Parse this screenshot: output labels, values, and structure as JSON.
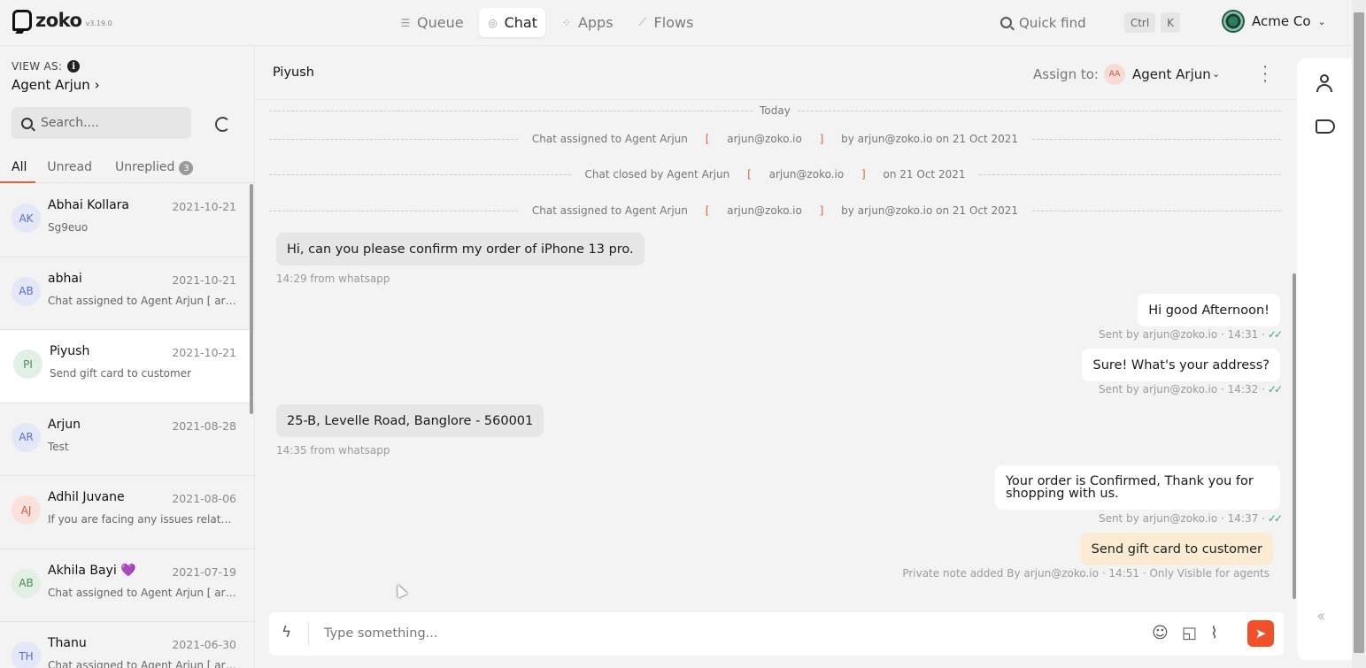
{
  "app": {
    "name": "zoko",
    "version": "v3.19.0"
  },
  "nav": {
    "items": [
      {
        "label": "Queue",
        "icon": "queue-icon"
      },
      {
        "label": "Chat",
        "icon": "chat-icon",
        "active": true
      },
      {
        "label": "Apps",
        "icon": "apps-grid-icon"
      },
      {
        "label": "Flows",
        "icon": "flows-icon"
      }
    ]
  },
  "quickfind": {
    "placeholder": "Quick find",
    "key1": "Ctrl",
    "key2": "K"
  },
  "org": {
    "name": "Acme Co"
  },
  "sidebar": {
    "view_as_label": "VIEW AS:",
    "view_as_agent": "Agent Arjun",
    "search_placeholder": "Search....",
    "tabs": [
      {
        "label": "All",
        "active": true
      },
      {
        "label": "Unread"
      },
      {
        "label": "Unreplied",
        "badge": "3"
      }
    ],
    "conversations": [
      {
        "initials": "AK",
        "name": "Abhai Kollara",
        "date": "2021-10-21",
        "preview": "Sg9euo",
        "avatar_bg": "#e3e7f7",
        "avatar_fg": "#5b6fc7"
      },
      {
        "initials": "AB",
        "name": "abhai",
        "date": "2021-10-21",
        "preview": "Chat assigned to Agent Arjun [ arjun@zoko.io ]",
        "avatar_bg": "#e3e7f7",
        "avatar_fg": "#5b6fc7"
      },
      {
        "initials": "PI",
        "name": "Piyush",
        "date": "2021-10-21",
        "preview": "Send gift card to customer",
        "avatar_bg": "#e1efe4",
        "avatar_fg": "#4f8a5c",
        "selected": true
      },
      {
        "initials": "AR",
        "name": "Arjun",
        "date": "2021-08-28",
        "preview": "Test",
        "avatar_bg": "#e3e7f7",
        "avatar_fg": "#5b6fc7"
      },
      {
        "initials": "AJ",
        "name": "Adhil Juvane",
        "date": "2021-08-06",
        "preview": "If you are facing any issues related to your order",
        "avatar_bg": "#fbe1dc",
        "avatar_fg": "#d05a3d"
      },
      {
        "initials": "AB",
        "name": "Akhila Bayi",
        "name_emoji": "💜",
        "date": "2021-07-19",
        "preview": "Chat assigned to Agent Arjun [ arjun@zoko.io ]",
        "avatar_bg": "#e1efe4",
        "avatar_fg": "#4f8a5c"
      },
      {
        "initials": "TH",
        "name": "Thanu",
        "date": "2021-06-30",
        "preview": "Chat assigned to Agent Arjun [ arjun@zoko.io ]",
        "avatar_bg": "#e3e7f7",
        "avatar_fg": "#5b6fc7"
      }
    ]
  },
  "chat": {
    "contact_name": "Piyush",
    "assign_label": "Assign to:",
    "assignee_initials": "AA",
    "assignee_name": "Agent Arjun",
    "day_label": "Today",
    "system_messages": [
      {
        "pre": "Chat assigned to Agent Arjun ",
        "lb": "[",
        "mid": " arjun@zoko.io ",
        "rb": "]",
        "post": " by arjun@zoko.io on 21 Oct 2021"
      },
      {
        "pre": "Chat closed by Agent Arjun ",
        "lb": "[",
        "mid": " arjun@zoko.io ",
        "rb": "]",
        "post": " on 21 Oct 2021"
      },
      {
        "pre": "Chat assigned to Agent Arjun ",
        "lb": "[",
        "mid": " arjun@zoko.io ",
        "rb": "]",
        "post": " by arjun@zoko.io on 21 Oct 2021"
      }
    ],
    "messages": [
      {
        "direction": "in",
        "text": "Hi, can you please confirm my order of iPhone 13 pro.",
        "meta": "14:29 from whatsapp"
      },
      {
        "direction": "out",
        "text": "Hi good Afternoon!",
        "meta": "Sent by arjun@zoko.io · 14:31 ·"
      },
      {
        "direction": "out",
        "text": "Sure! What's your address?",
        "meta": "Sent by arjun@zoko.io · 14:32 ·"
      },
      {
        "direction": "in",
        "text": "25-B, Levelle Road, Banglore - 560001",
        "meta": "14:35 from whatsapp"
      },
      {
        "direction": "out",
        "text": "Your order is Confirmed, Thank you for shopping with us.",
        "meta": "Sent by arjun@zoko.io · 14:37 ·"
      }
    ],
    "private_note": {
      "text": "Send gift card to customer",
      "meta": "Private note added By arjun@zoko.io · 14:51 · Only Visible for agents"
    },
    "composer_placeholder": "Type something...",
    "read_tick": "✓✓"
  },
  "colors": {
    "accent": "#f0502a",
    "note_bg": "#fcebd3",
    "tick": "#3aa57a"
  }
}
